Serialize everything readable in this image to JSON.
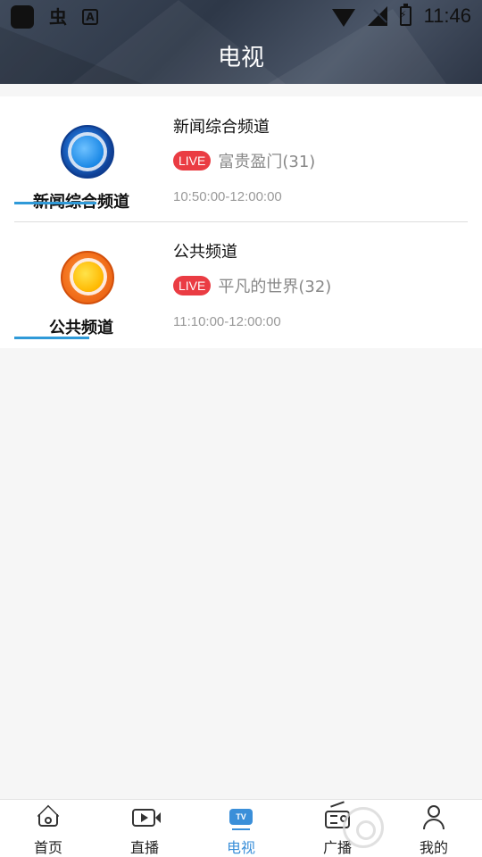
{
  "status_bar": {
    "time": "11:46",
    "icons": [
      "app-square-icon",
      "bug-icon",
      "a-icon",
      "wifi-icon",
      "no-signal-icon",
      "battery-charging-icon"
    ]
  },
  "header": {
    "title": "电视"
  },
  "channels": [
    {
      "logo_text": "新闻综合频道",
      "logo_color": "#1b66c6",
      "name": "新闻综合频道",
      "live_label": "LIVE",
      "program": "富贵盈门(31)",
      "time": "10:50:00-12:00:00"
    },
    {
      "logo_text": "公共频道",
      "logo_color": "#f16d1a",
      "name": "公共频道",
      "live_label": "LIVE",
      "program": "平凡的世界(32)",
      "time": "11:10:00-12:00:00"
    }
  ],
  "bottom_nav": {
    "active": "电视",
    "active_color": "#3a8fd9",
    "items": [
      {
        "label": "首页",
        "icon": "home-icon"
      },
      {
        "label": "直播",
        "icon": "live-video-icon"
      },
      {
        "label": "电视",
        "icon": "tv-icon",
        "icon_text": "TV"
      },
      {
        "label": "广播",
        "icon": "radio-icon"
      },
      {
        "label": "我的",
        "icon": "user-icon"
      }
    ]
  },
  "colors": {
    "live_badge": "#ea3c43",
    "accent": "#3a8fd9"
  }
}
